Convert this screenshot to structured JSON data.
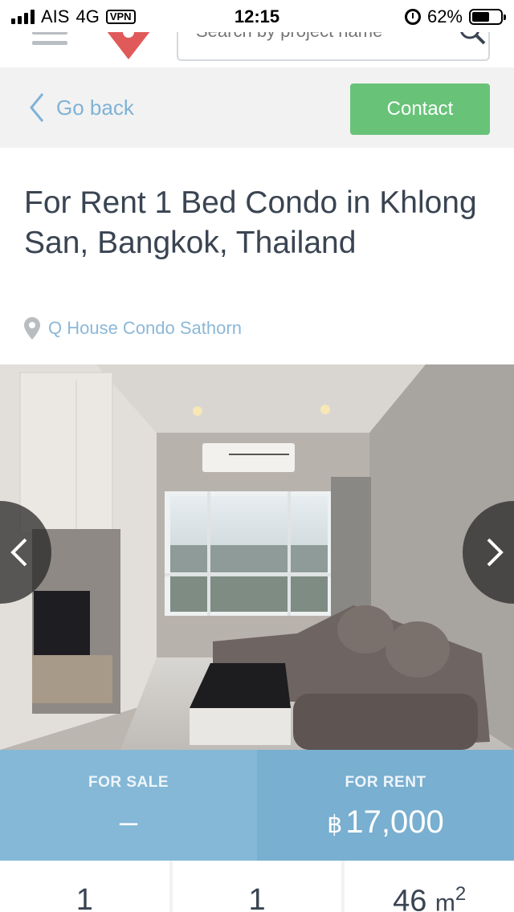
{
  "status_bar": {
    "carrier": "AIS",
    "network": "4G",
    "vpn": "VPN",
    "time": "12:15",
    "battery": "62%",
    "battery_level": 0.62
  },
  "topnav": {
    "search_placeholder": "Search by project name",
    "logo_color": "#e05a5a"
  },
  "backbar": {
    "back_label": "Go back",
    "contact_label": "Contact"
  },
  "listing": {
    "title": "For Rent 1 Bed Condo in Khlong San, Bangkok, Thailand",
    "project": "Q House Condo Sathorn"
  },
  "price": {
    "sale_label": "FOR SALE",
    "sale_value": "–",
    "rent_label": "FOR RENT",
    "currency": "฿",
    "rent_value": "17,000"
  },
  "stats": {
    "bedrooms": "1",
    "bathrooms": "1",
    "area": "46",
    "area_unit": "m",
    "area_power": "2"
  },
  "colors": {
    "contact": "#68c379",
    "link": "#7fb3d6",
    "price_band": "#79afd0"
  }
}
